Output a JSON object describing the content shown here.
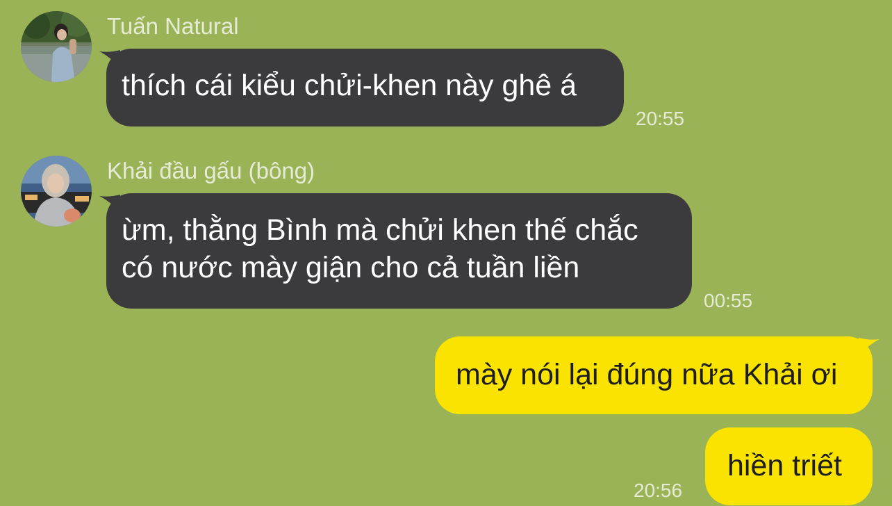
{
  "colors": {
    "background": "#9bb357",
    "incoming_bubble": "#3b3b3d",
    "outgoing_bubble": "#fae300",
    "meta_text": "#e6ebd6"
  },
  "messages": [
    {
      "direction": "incoming",
      "sender": "Tuấn Natural",
      "avatar": "user-photo",
      "lines": [
        "thích cái kiểu chửi-khen này ghê á"
      ],
      "time": "20:55"
    },
    {
      "direction": "incoming",
      "sender": "Khải đầu gấu (bông)",
      "avatar": "user-photo",
      "lines": [
        "ừm, thằng Bình mà chửi khen thế chắc",
        "có nước mày giận cho cả tuần liền"
      ],
      "time": "00:55"
    },
    {
      "direction": "outgoing",
      "lines": [
        "mày nói lại đúng nữa Khải ơi"
      ],
      "time": ""
    },
    {
      "direction": "outgoing",
      "lines": [
        "hiền triết"
      ],
      "time": "20:56"
    }
  ]
}
